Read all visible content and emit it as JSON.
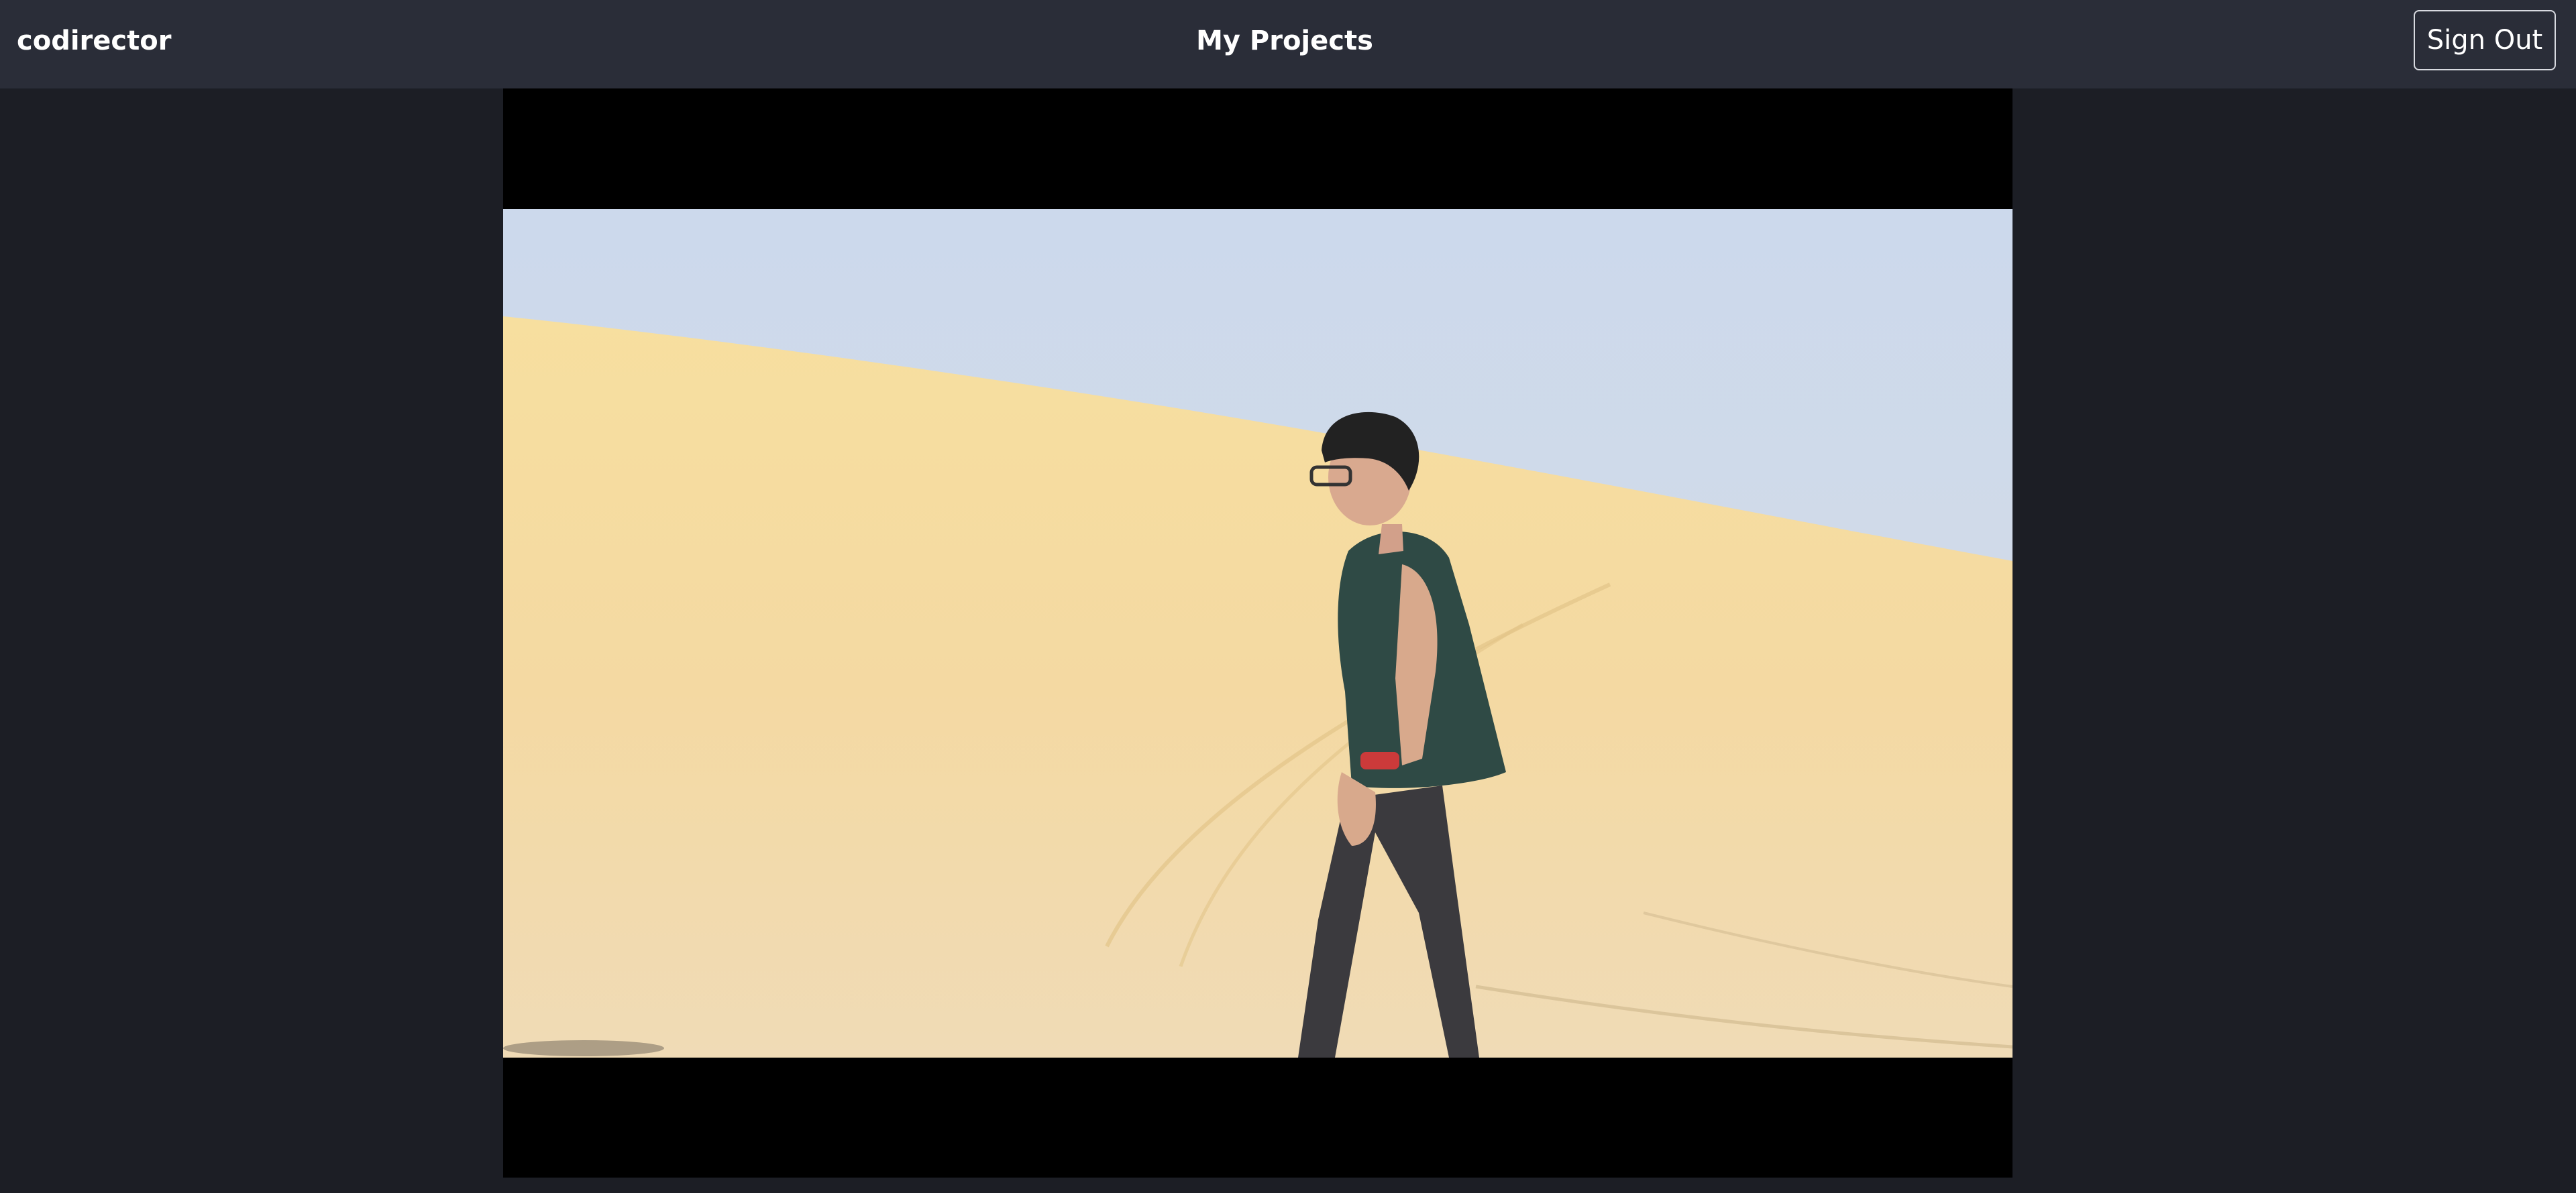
{
  "app": {
    "brand": "codirector"
  },
  "header": {
    "title": "My Projects",
    "sign_out_label": "Sign Out"
  },
  "video": {
    "scene": "desert-walk-frame",
    "colors": {
      "page_bg": "#1c1e25",
      "topbar_bg": "#2a2d38",
      "letterbox": "#000000",
      "sky": "#cdd9e8",
      "sand": "#f3d9a0"
    }
  }
}
